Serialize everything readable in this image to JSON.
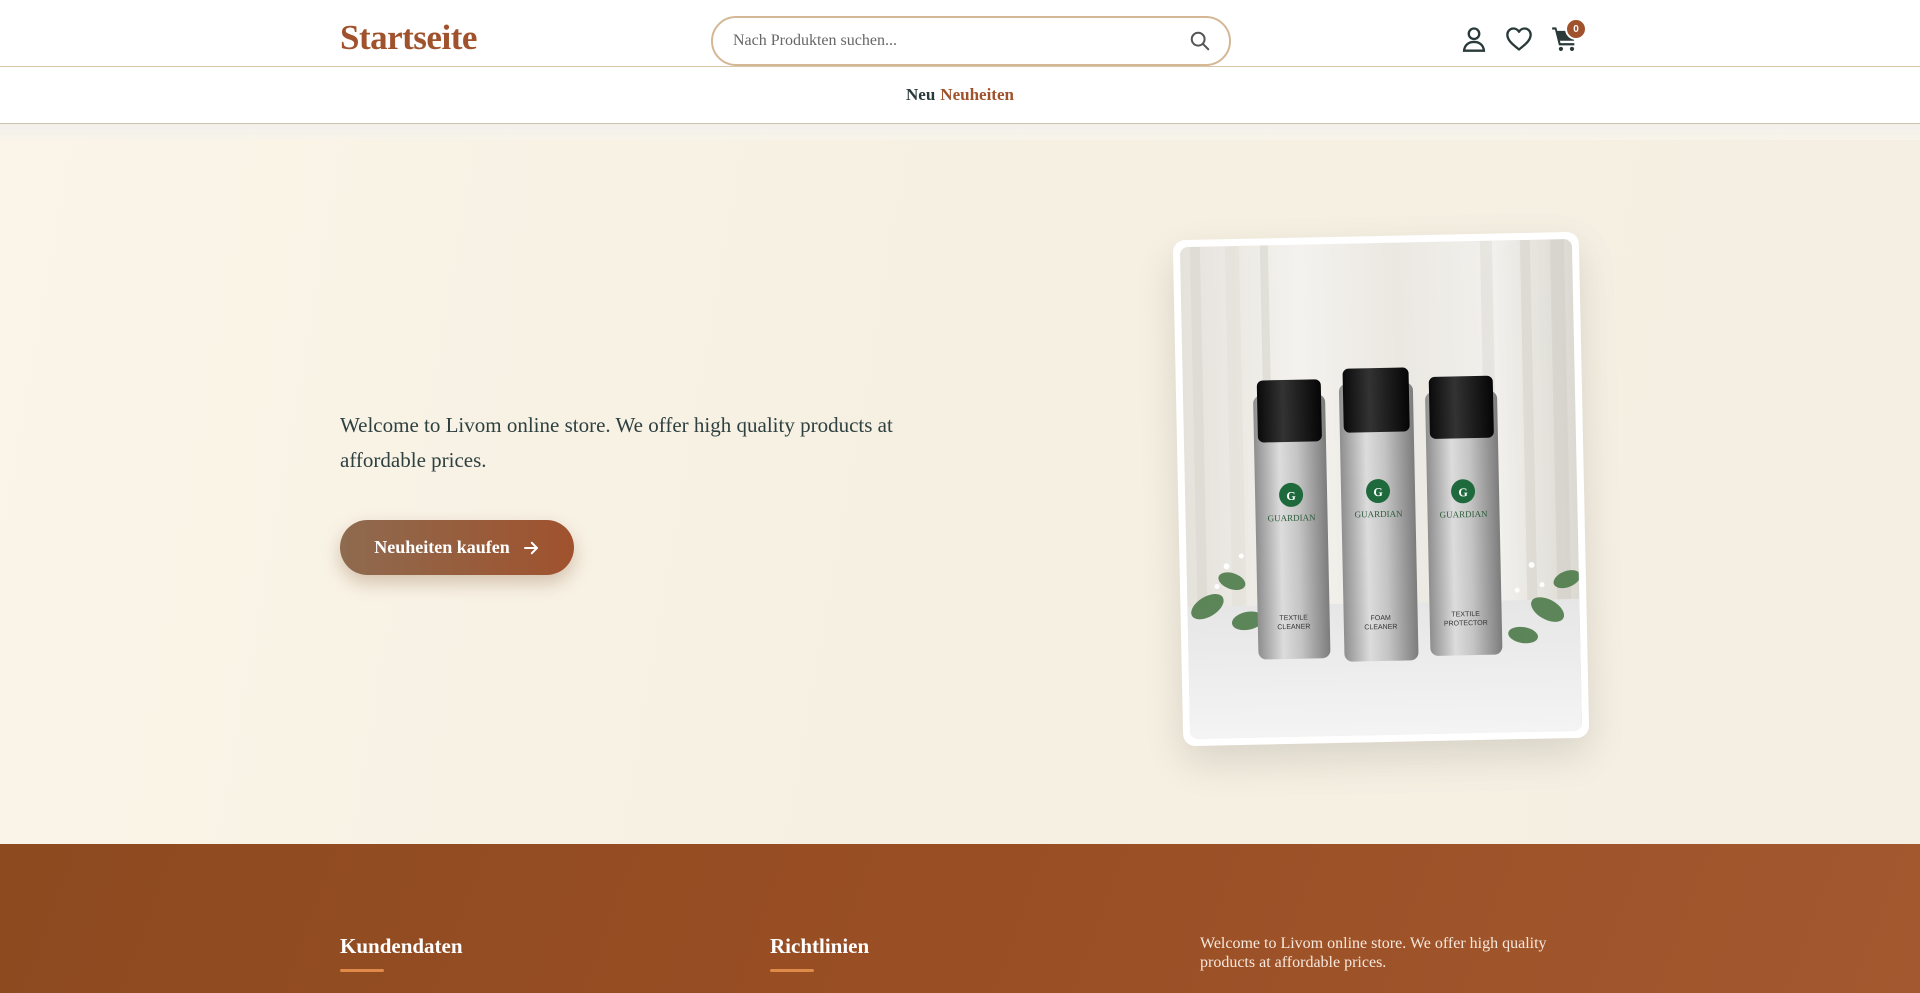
{
  "header": {
    "logo": "Startseite",
    "search_placeholder": "Nach Produkten suchen...",
    "cart_count": "0",
    "icons": [
      "search-icon",
      "user-icon",
      "heart-icon",
      "cart-icon"
    ]
  },
  "nav": {
    "prefix": "Neu",
    "link": "Neuheiten"
  },
  "hero": {
    "text": "Welcome to Livom online store. We offer high quality products at affordable prices.",
    "button_label": "Neuheiten kaufen",
    "image_product_names": [
      "TEXTILE CLEANER",
      "FOAM CLEANER",
      "TEXTILE PROTECTOR"
    ],
    "image_brand": "GUARDIAN"
  },
  "footer": {
    "col1_heading": "Kundendaten",
    "col2_heading": "Richtlinien",
    "about_text": "Welcome to Livom online store. We offer high quality products at affordable prices."
  },
  "colors": {
    "brand": "#a0522d",
    "text_dark": "#2e4040",
    "hero_bg": "#f8f2e6",
    "footer_bg": "#9a4e24"
  }
}
